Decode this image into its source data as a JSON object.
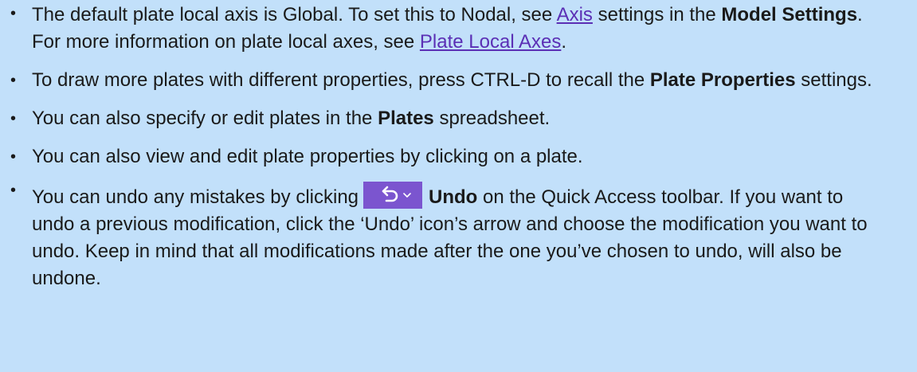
{
  "items": [
    {
      "pre": "The default plate local axis is Global. To set this to Nodal, see ",
      "link1": "Axis",
      "mid1": " settings in the ",
      "bold1": "Model Settings",
      "mid2": ". For more information on plate local axes, see ",
      "link2": "Plate Local Axes",
      "post": "."
    },
    {
      "pre": "To draw more plates with different properties, press CTRL-D to recall the ",
      "bold1": "Plate Properties",
      "post": " settings."
    },
    {
      "pre": "You can also specify or edit plates in the ",
      "bold1": "Plates",
      "post": " spreadsheet."
    },
    {
      "text": "You can also view and edit plate properties by clicking on a plate."
    },
    {
      "pre": "You can undo any mistakes by clicking",
      "icon": "undo-icon",
      "bold1": "Undo",
      "post": " on the Quick Access toolbar. If you want to undo a previous modification, click the ‘Undo’ icon’s arrow and choose the modification you want to undo. Keep in mind that all modifications made after the one you’ve chosen to undo, will also be undone."
    }
  ],
  "colors": {
    "background": "#c2e0fa",
    "link": "#5b2fb5",
    "undo_button": "#7b55cf"
  }
}
